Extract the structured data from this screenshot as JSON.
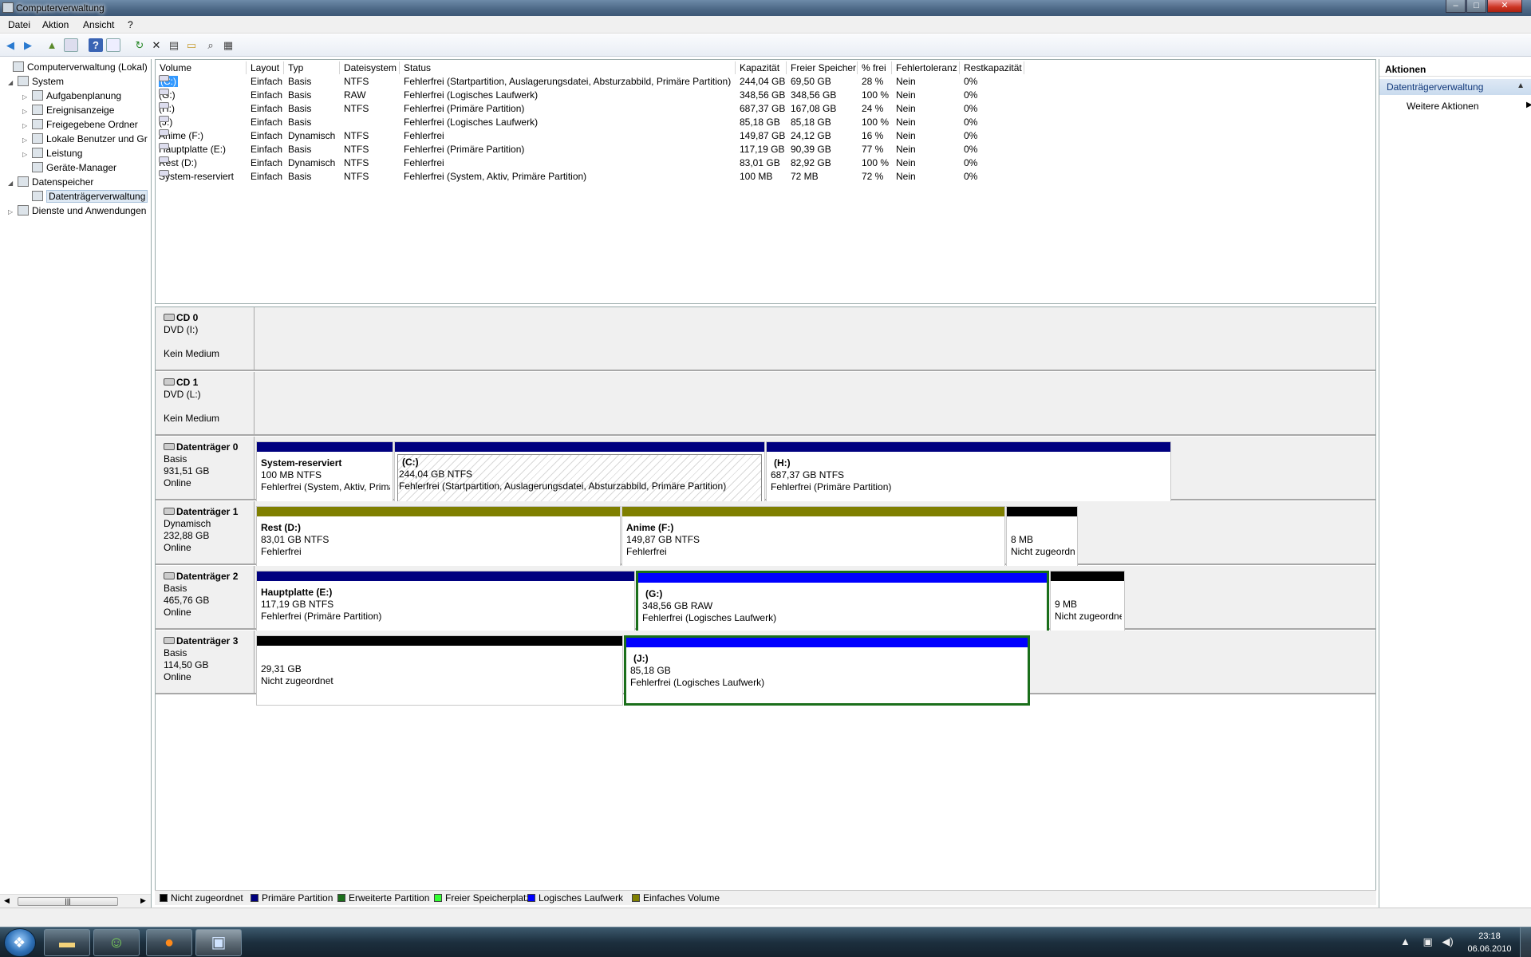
{
  "window": {
    "title": "Computerverwaltung",
    "min": "–",
    "max": "□",
    "close": "✕"
  },
  "menu": [
    "Datei",
    "Aktion",
    "Ansicht",
    "?"
  ],
  "tree": [
    {
      "label": "Computerverwaltung (Lokal)",
      "level": 0,
      "exp": "",
      "icon": "computer-icon"
    },
    {
      "label": "System",
      "level": 1,
      "exp": "◢",
      "icon": "tools-icon"
    },
    {
      "label": "Aufgabenplanung",
      "level": 2,
      "exp": "▷",
      "icon": "clock-icon"
    },
    {
      "label": "Ereignisanzeige",
      "level": 2,
      "exp": "▷",
      "icon": "event-log-icon"
    },
    {
      "label": "Freigegebene Ordner",
      "level": 2,
      "exp": "▷",
      "icon": "shared-folder-icon"
    },
    {
      "label": "Lokale Benutzer und Gr",
      "level": 2,
      "exp": "▷",
      "icon": "users-icon"
    },
    {
      "label": "Leistung",
      "level": 2,
      "exp": "▷",
      "icon": "performance-icon"
    },
    {
      "label": "Geräte-Manager",
      "level": 2,
      "exp": "",
      "icon": "device-manager-icon"
    },
    {
      "label": "Datenspeicher",
      "level": 1,
      "exp": "◢",
      "icon": "storage-icon"
    },
    {
      "label": "Datenträgerverwaltung",
      "level": 2,
      "exp": "",
      "icon": "disk-management-icon",
      "selected": true
    },
    {
      "label": "Dienste und Anwendungen",
      "level": 1,
      "exp": "▷",
      "icon": "services-icon"
    }
  ],
  "volume_list": {
    "columns": [
      "Volume",
      "Layout",
      "Typ",
      "Dateisystem",
      "Status",
      "Kapazität",
      "Freier Speicher",
      "% frei",
      "Fehlertoleranz",
      "Restkapazität"
    ],
    "rows": [
      [
        "(C:)",
        "Einfach",
        "Basis",
        "NTFS",
        "Fehlerfrei (Startpartition, Auslagerungsdatei, Absturzabbild, Primäre Partition)",
        "244,04 GB",
        "69,50 GB",
        "28 %",
        "Nein",
        "0%"
      ],
      [
        "(G:)",
        "Einfach",
        "Basis",
        "RAW",
        "Fehlerfrei (Logisches Laufwerk)",
        "348,56 GB",
        "348,56 GB",
        "100 %",
        "Nein",
        "0%"
      ],
      [
        "(H:)",
        "Einfach",
        "Basis",
        "NTFS",
        "Fehlerfrei (Primäre Partition)",
        "687,37 GB",
        "167,08 GB",
        "24 %",
        "Nein",
        "0%"
      ],
      [
        "(J:)",
        "Einfach",
        "Basis",
        "",
        "Fehlerfrei (Logisches Laufwerk)",
        "85,18 GB",
        "85,18 GB",
        "100 %",
        "Nein",
        "0%"
      ],
      [
        "Anime (F:)",
        "Einfach",
        "Dynamisch",
        "NTFS",
        "Fehlerfrei",
        "149,87 GB",
        "24,12 GB",
        "16 %",
        "Nein",
        "0%"
      ],
      [
        "Hauptplatte (E:)",
        "Einfach",
        "Basis",
        "NTFS",
        "Fehlerfrei (Primäre Partition)",
        "117,19 GB",
        "90,39 GB",
        "77 %",
        "Nein",
        "0%"
      ],
      [
        "Rest (D:)",
        "Einfach",
        "Dynamisch",
        "NTFS",
        "Fehlerfrei",
        "83,01 GB",
        "82,92 GB",
        "100 %",
        "Nein",
        "0%"
      ],
      [
        "System-reserviert",
        "Einfach",
        "Basis",
        "NTFS",
        "Fehlerfrei (System, Aktiv, Primäre Partition)",
        "100 MB",
        "72 MB",
        "72 %",
        "Nein",
        "0%"
      ]
    ]
  },
  "disks": [
    {
      "name": "CD 0",
      "type": "DVD (I:)",
      "size": "",
      "state": "Kein Medium",
      "cd": true,
      "partitions": []
    },
    {
      "name": "CD 1",
      "type": "DVD (L:)",
      "size": "",
      "state": "Kein Medium",
      "cd": true,
      "partitions": []
    },
    {
      "name": "Datenträger 0",
      "type": "Basis",
      "size": "931,51 GB",
      "state": "Online",
      "partitions": [
        {
          "title": "System-reserviert",
          "size": "100 MB NTFS",
          "status": "Fehlerfrei (System, Aktiv, Primäre Parti",
          "color": "#00007f",
          "bold": true
        },
        {
          "title": "(C:)",
          "size": "244,04 GB NTFS",
          "status": "Fehlerfrei (Startpartition, Auslagerungsdatei, Absturzabbild, Primäre Partition)",
          "color": "#00007f",
          "hatch": true
        },
        {
          "title": "(H:)",
          "size": "687,37 GB NTFS",
          "status": "Fehlerfrei (Primäre Partition)",
          "color": "#00007f"
        }
      ]
    },
    {
      "name": "Datenträger 1",
      "type": "Dynamisch",
      "size": "232,88 GB",
      "state": "Online",
      "partitions": [
        {
          "title": "Rest  (D:)",
          "size": "83,01 GB NTFS",
          "status": "Fehlerfrei",
          "color": "#7f7f00",
          "bold": true
        },
        {
          "title": "Anime  (F:)",
          "size": "149,87 GB NTFS",
          "status": "Fehlerfrei",
          "color": "#7f7f00",
          "bold": true
        },
        {
          "title": "",
          "size": "8 MB",
          "status": "Nicht zugeordnet",
          "color": "#000000"
        }
      ]
    },
    {
      "name": "Datenträger 2",
      "type": "Basis",
      "size": "465,76 GB",
      "state": "Online",
      "partitions": [
        {
          "title": "Hauptplatte  (E:)",
          "size": "117,19 GB NTFS",
          "status": "Fehlerfrei (Primäre Partition)",
          "color": "#00007f",
          "bold": true
        },
        {
          "title": "(G:)",
          "size": "348,56 GB RAW",
          "status": "Fehlerfrei (Logisches Laufwerk)",
          "color": "#0000ff",
          "green": true
        },
        {
          "title": "",
          "size": "9 MB",
          "status": "Nicht zugeordnet",
          "color": "#000000"
        }
      ]
    },
    {
      "name": "Datenträger 3",
      "type": "Basis",
      "size": "114,50 GB",
      "state": "Online",
      "partitions": [
        {
          "title": "",
          "size": "29,31 GB",
          "status": "Nicht zugeordnet",
          "color": "#000000"
        },
        {
          "title": "(J:)",
          "size": "85,18 GB",
          "status": "Fehlerfrei (Logisches Laufwerk)",
          "color": "#0000ff",
          "green": true
        }
      ]
    }
  ],
  "legend": [
    {
      "label": "Nicht zugeordnet",
      "color": "#000000"
    },
    {
      "label": "Primäre Partition",
      "color": "#00007f"
    },
    {
      "label": "Erweiterte Partition",
      "color": "#1b6f1b"
    },
    {
      "label": "Freier Speicherplatz",
      "color": "#33ff33"
    },
    {
      "label": "Logisches Laufwerk",
      "color": "#0000ff"
    },
    {
      "label": "Einfaches Volume",
      "color": "#7f7f00"
    }
  ],
  "actions": {
    "header": "Aktionen",
    "section": "Datenträgerverwaltung",
    "item": "Weitere Aktionen"
  },
  "taskbar": {
    "time": "23:18",
    "date": "06.06.2010"
  }
}
